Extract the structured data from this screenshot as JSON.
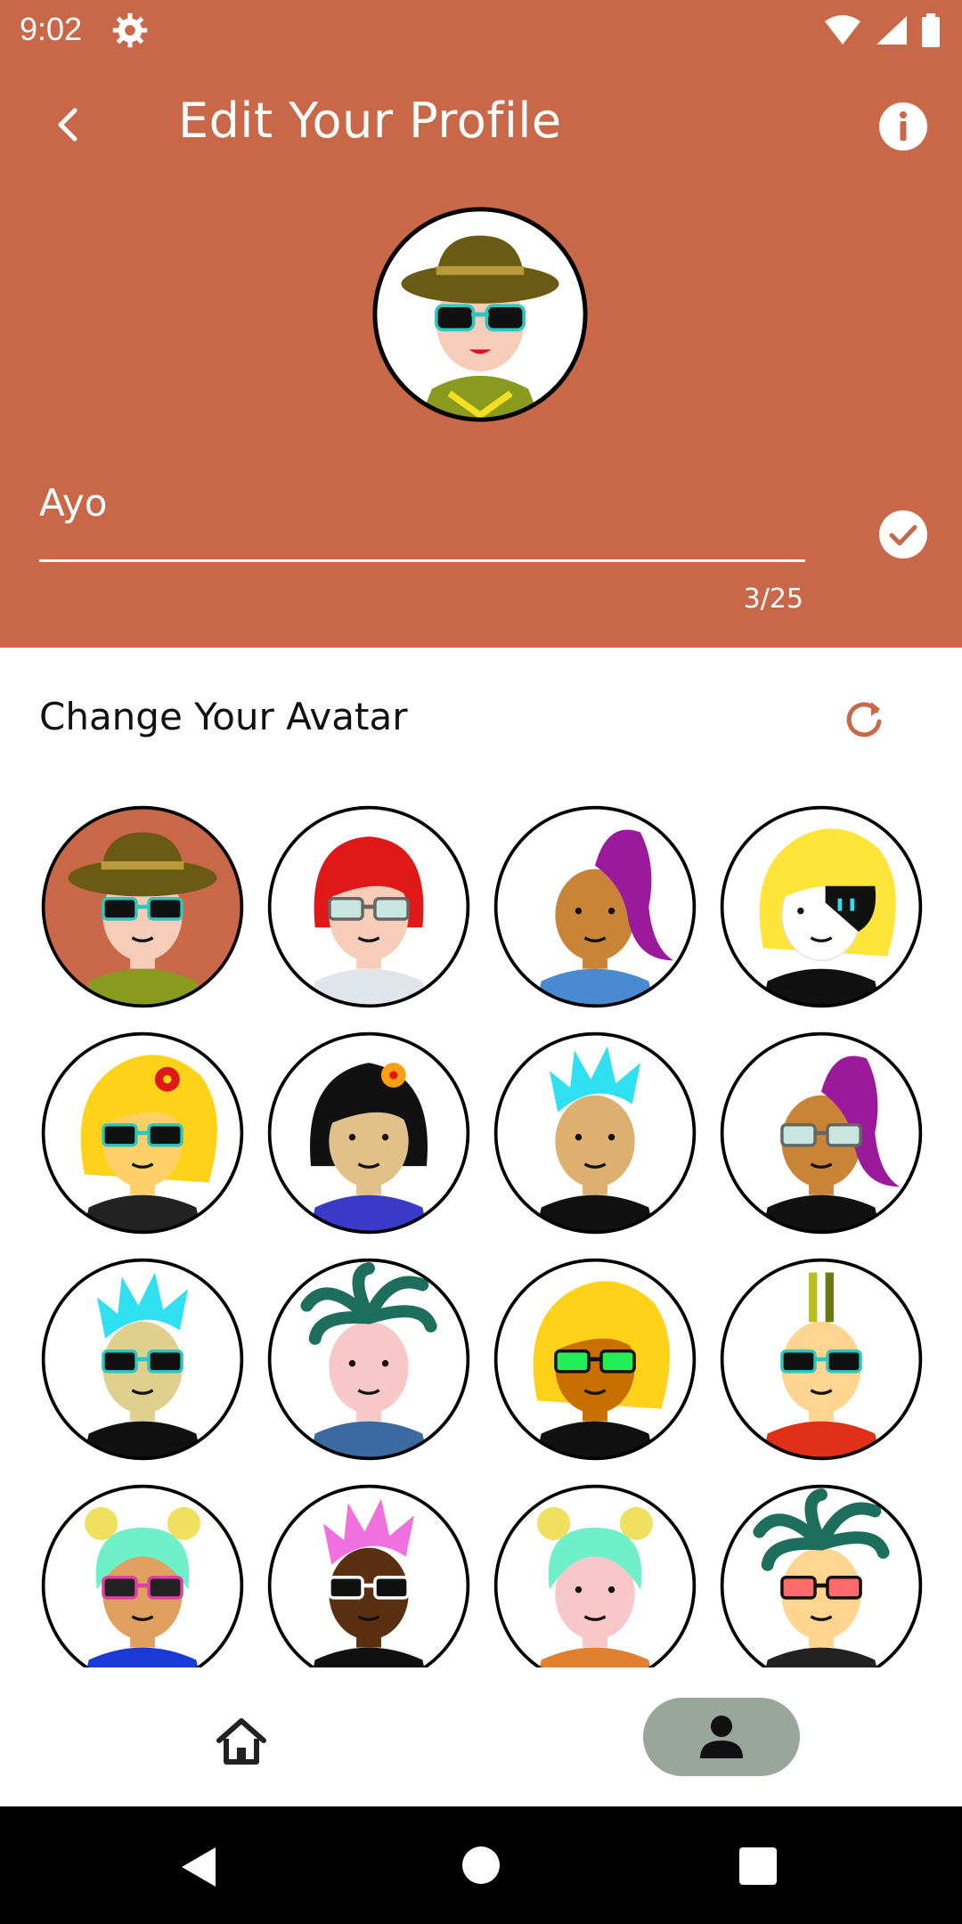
{
  "status_bar": {
    "time": "9:02"
  },
  "header": {
    "title": "Edit Your Profile",
    "name_value": "Ayo",
    "char_counter": "3/25"
  },
  "avatar_section": {
    "title": "Change Your Avatar",
    "count_visible": 16
  },
  "bottom_nav": {
    "items": [
      {
        "icon": "home-icon",
        "active": false
      },
      {
        "icon": "person-icon",
        "active": true
      }
    ]
  },
  "colors": {
    "primary": "#c86848",
    "selected_nav_bg": "#9aa59c"
  }
}
